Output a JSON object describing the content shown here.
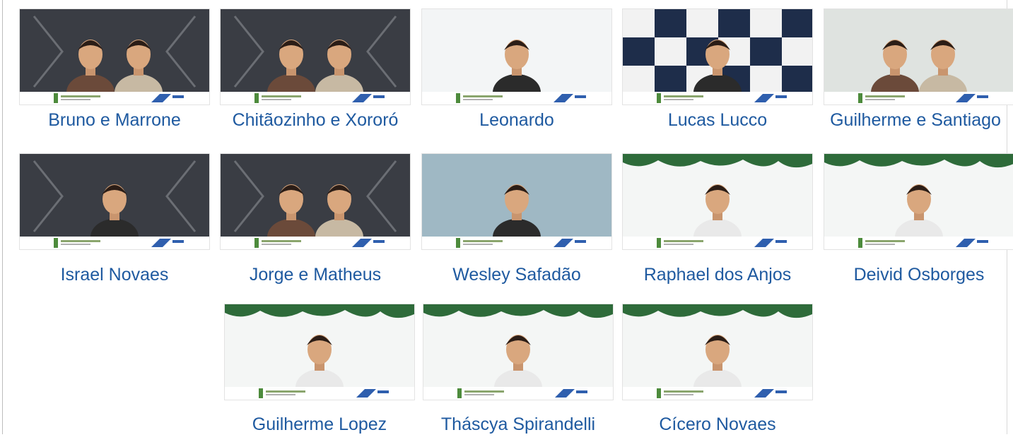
{
  "videos": [
    {
      "name": "Bruno e Marrone",
      "scene": "dark",
      "people": 2
    },
    {
      "name": "Chitãozinho e Xororó",
      "scene": "dark",
      "people": 2
    },
    {
      "name": "Leonardo",
      "scene": "white",
      "people": 1
    },
    {
      "name": "Lucas Lucco",
      "scene": "checker",
      "people": 1
    },
    {
      "name": "Guilherme e Santiago",
      "scene": "light",
      "people": 2
    },
    {
      "name": "Israel Novaes",
      "scene": "dark",
      "people": 1
    },
    {
      "name": "Jorge e Matheus",
      "scene": "dark",
      "people": 2
    },
    {
      "name": "Wesley Safadão",
      "scene": "blue",
      "people": 1
    },
    {
      "name": "Raphael dos Anjos",
      "scene": "pine",
      "people": 1
    },
    {
      "name": "Deivid Osborges",
      "scene": "pine",
      "people": 1
    },
    {
      "name": "Guilherme Lopez",
      "scene": "pine",
      "people": 1
    },
    {
      "name": "Tháscya Spirandelli",
      "scene": "pine",
      "people": 1
    },
    {
      "name": "Cícero Novaes",
      "scene": "pine",
      "people": 1
    }
  ],
  "icons": {
    "thumbnail": "video-thumbnail-icon",
    "sponsor": "cdl-logo-icon"
  },
  "colors": {
    "caption": "#1f5aa0",
    "sponsor_blue": "#2f5fae",
    "pine": "#2e6b3a"
  }
}
